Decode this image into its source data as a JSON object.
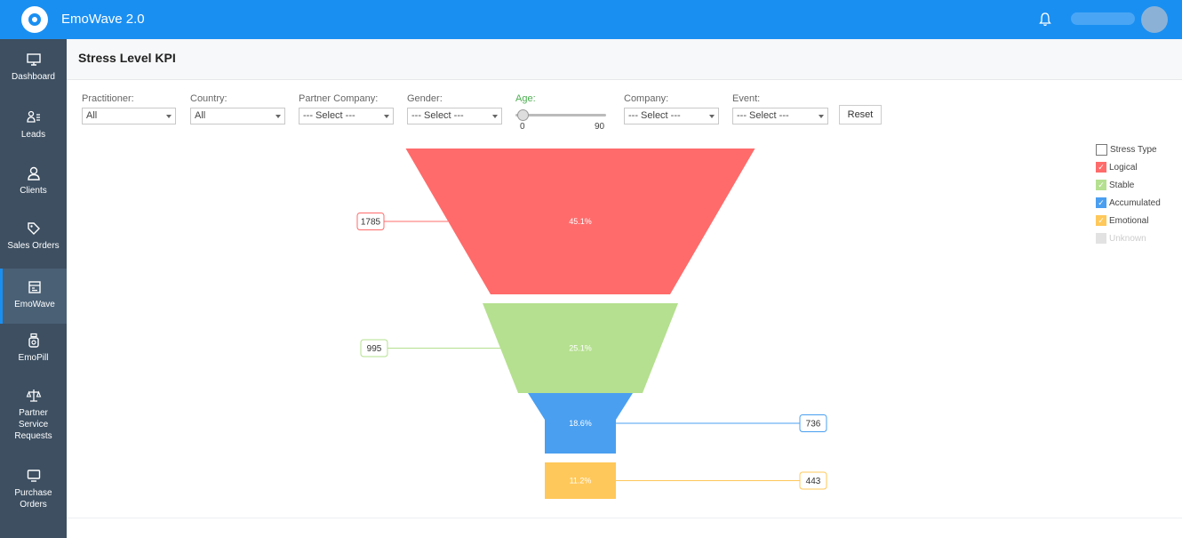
{
  "app": {
    "title": "EmoWave 2.0"
  },
  "sidebar": {
    "items": [
      {
        "label": "Dashboard",
        "icon": "monitor-icon"
      },
      {
        "label": "Leads",
        "icon": "leads-icon"
      },
      {
        "label": "Clients",
        "icon": "user-icon"
      },
      {
        "label": "Sales Orders",
        "icon": "tag-icon"
      },
      {
        "label": "EmoWave",
        "icon": "emowave-icon",
        "active": true
      },
      {
        "label": "EmoPill",
        "icon": "pill-icon"
      },
      {
        "label": "Partner Service Requests",
        "icon": "scale-icon"
      },
      {
        "label": "Purchase Orders",
        "icon": "screen-icon"
      }
    ]
  },
  "page": {
    "title": "Stress Level KPI"
  },
  "filters": {
    "practitioner": {
      "label": "Practitioner:",
      "value": "All"
    },
    "country": {
      "label": "Country:",
      "value": "All"
    },
    "partner_company": {
      "label": "Partner Company:",
      "value": "--- Select ---"
    },
    "gender": {
      "label": "Gender:",
      "value": "--- Select ---"
    },
    "age": {
      "label": "Age:",
      "min": "0",
      "max": "90"
    },
    "company": {
      "label": "Company:",
      "value": "--- Select ---"
    },
    "event": {
      "label": "Event:",
      "value": "--- Select ---"
    },
    "reset_label": "Reset"
  },
  "legend": {
    "title": "Stress Type",
    "items": [
      {
        "label": "Logical",
        "color": "#ff6b6b",
        "checked": true
      },
      {
        "label": "Stable",
        "color": "#b5e08f",
        "checked": true
      },
      {
        "label": "Accumulated",
        "color": "#4a9ff0",
        "checked": true
      },
      {
        "label": "Emotional",
        "color": "#ffc85a",
        "checked": true
      },
      {
        "label": "Unknown",
        "color": "#d9d9d9",
        "checked": false
      }
    ]
  },
  "chart_data": {
    "type": "funnel",
    "series": [
      {
        "name": "Logical",
        "value": 1785,
        "percent_label": "45.1%",
        "color": "#ff6b6b"
      },
      {
        "name": "Stable",
        "value": 995,
        "percent_label": "25.1%",
        "color": "#b5e08f"
      },
      {
        "name": "Accumulated",
        "value": 736,
        "percent_label": "18.6%",
        "color": "#4a9ff0"
      },
      {
        "name": "Emotional",
        "value": 443,
        "percent_label": "11.2%",
        "color": "#ffc85a"
      }
    ]
  }
}
